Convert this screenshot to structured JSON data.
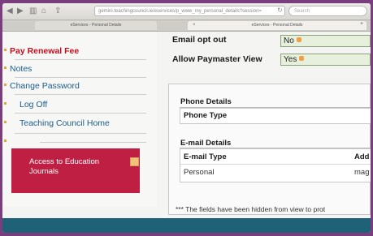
{
  "browser": {
    "url": "gemini.teachingcouncil.ie/eservices/p_www_my_personal_details?session=",
    "search_placeholder": "Search",
    "tabs": [
      {
        "label": "eServices - Personal Details"
      },
      {
        "label": "eServices - Personal Details"
      }
    ]
  },
  "sidebar": {
    "items": [
      {
        "label": "Pay Renewal Fee"
      },
      {
        "label": "Notes"
      },
      {
        "label": "Change Password"
      },
      {
        "label": "Log Off"
      },
      {
        "label": "Teaching Council Home"
      }
    ],
    "journals_label": "Access to Education Journals"
  },
  "fields": {
    "email_opt_out_label": "Email opt out",
    "email_opt_out_value": "No",
    "paymaster_label": "Allow Paymaster View",
    "paymaster_value": "Yes"
  },
  "phone": {
    "title": "Phone Details",
    "header": "Phone Type"
  },
  "email": {
    "title": "E-mail Details",
    "headers": [
      "E-mail Type",
      "Add"
    ],
    "rows": [
      [
        "Personal",
        "mag"
      ]
    ]
  },
  "footnote": "*** The fields have been hidden from view to prot",
  "colors": {
    "active_link": "#c01020",
    "link": "#1b5c8c",
    "journals_bg": "#c01f44",
    "field_bg": "#e6f0dc",
    "bottom_band": "#1f6278"
  }
}
